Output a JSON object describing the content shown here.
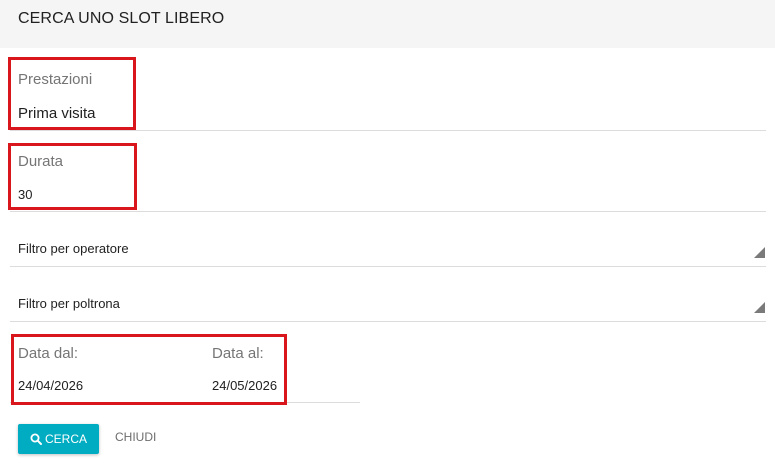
{
  "header": {
    "title": "CERCA UNO SLOT LIBERO"
  },
  "form": {
    "prestazioni": {
      "label": "Prestazioni",
      "value": "Prima visita"
    },
    "durata": {
      "label": "Durata",
      "value": "30"
    },
    "filtro_operatore": {
      "value": "Filtro per operatore"
    },
    "filtro_poltrona": {
      "value": "Filtro per poltrona"
    },
    "data_dal": {
      "label": "Data dal:",
      "value": "24/04/2026"
    },
    "data_al": {
      "label": "Data al:",
      "value": "24/05/2026"
    }
  },
  "actions": {
    "search_label": "CERCA",
    "close_label": "CHIUDI"
  },
  "icons": {
    "search": "search-icon",
    "dropdown": "dropdown-arrow-icon"
  },
  "colors": {
    "primary": "#00acc1",
    "highlight": "#d9161c",
    "header_bg": "#f5f5f5"
  }
}
